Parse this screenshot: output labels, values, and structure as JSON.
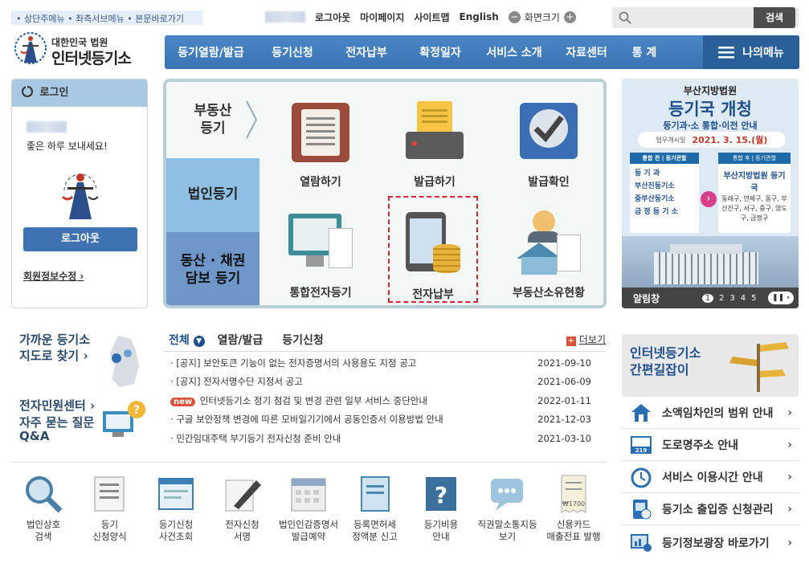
{
  "skip_links": "• 상단주메뉴 • 좌측서브메뉴 • 본문바로가기",
  "util": {
    "logout": "로그아웃",
    "mypage": "마이페이지",
    "sitemap": "사이트맵",
    "english": "English",
    "zoom": "화면크기",
    "minus": "−",
    "plus": "+"
  },
  "search": {
    "button": "검색",
    "placeholder": ""
  },
  "logo": {
    "line1": "대한민국 법원",
    "line2": "인터넷등기소"
  },
  "nav": [
    "등기열람/발급",
    "등기신청",
    "전자납부",
    "확정일자",
    "서비스 소개",
    "자료센터",
    "통 계"
  ],
  "my_menu": "나의메뉴",
  "login": {
    "header": "로그인",
    "greeting": "좋은 하루 보내세요!",
    "logout_button": "로그아웃",
    "member_info": "회원정보수정"
  },
  "categories": {
    "realestate": "부동산\n등기",
    "corporate": "법인등기",
    "movable": "동산 · 채권\n담보 등기"
  },
  "services": [
    "열람하기",
    "발급하기",
    "발급확인",
    "통합전자등기",
    "전자납부",
    "부동산소유현황"
  ],
  "banner": {
    "title1": "부산지방법원",
    "title2": "등기국 개청",
    "subtitle": "등기과·소 통합·이전 안내",
    "date_label": "업무개시일",
    "date": "2021. 3. 15.(월)",
    "before_header": "통합 전 | 등기관할",
    "before_items": [
      "등 기 과",
      "부산진등기소",
      "중부산등기소",
      "금 정 등 기 소"
    ],
    "after_header": "통합 후 | 등기관할",
    "after_title": "부산지방법원 등기국",
    "after_desc": "동래구, 연제구, 동구, 부산진구, 서구, 중구, 영도구, 금정구",
    "footer_label": "알림창",
    "pages": [
      "1",
      "2",
      "3",
      "4",
      "5"
    ]
  },
  "left_links": {
    "map": "가까운 등기소\n지도로 찾기",
    "center": "전자민원센터",
    "faq": "자주 묻는 질문\nQ&A"
  },
  "news": {
    "tabs": [
      "전체",
      "열람/발급",
      "등기신청"
    ],
    "more": "더보기",
    "new_badge": "new",
    "items": [
      {
        "title": "[공지] 보안토큰 기능이 없는 전자증명서의 사용용도 지정 공고",
        "date": "2021-09-10"
      },
      {
        "title": "[공지] 전자서명수단 지정서 공고",
        "date": "2021-06-09"
      },
      {
        "title": "인터넷등기소 정기 점검 및 변경 관련 일부 서비스 중단안내",
        "date": "2022-01-11"
      },
      {
        "title": "구글 보안정책 변경에 따른 모바일기기에서 공동인증서 이용방법 안내",
        "date": "2021-12-03"
      },
      {
        "title": "민간임대주택 부기등기 전자신청 준비 안내",
        "date": "2021-03-10"
      }
    ]
  },
  "quick": [
    "법인상호\n검색",
    "등기\n신청양식",
    "등기신청\n사건조회",
    "전자신청\n서명",
    "법인인감증명서\n발급예약",
    "등록면허세\n정액분 신고",
    "등기비용\n안내",
    "직권말소통지등\n보기",
    "신용카드\n매출전표 발행"
  ],
  "guide": {
    "title": "인터넷등기소\n간편길잡이"
  },
  "right_links": [
    "소액임차인의 범위 안내",
    "도로명주소 안내",
    "서비스 이용시간 안내",
    "등기소 출입증 신청관리",
    "등기정보광장 바로가기"
  ]
}
